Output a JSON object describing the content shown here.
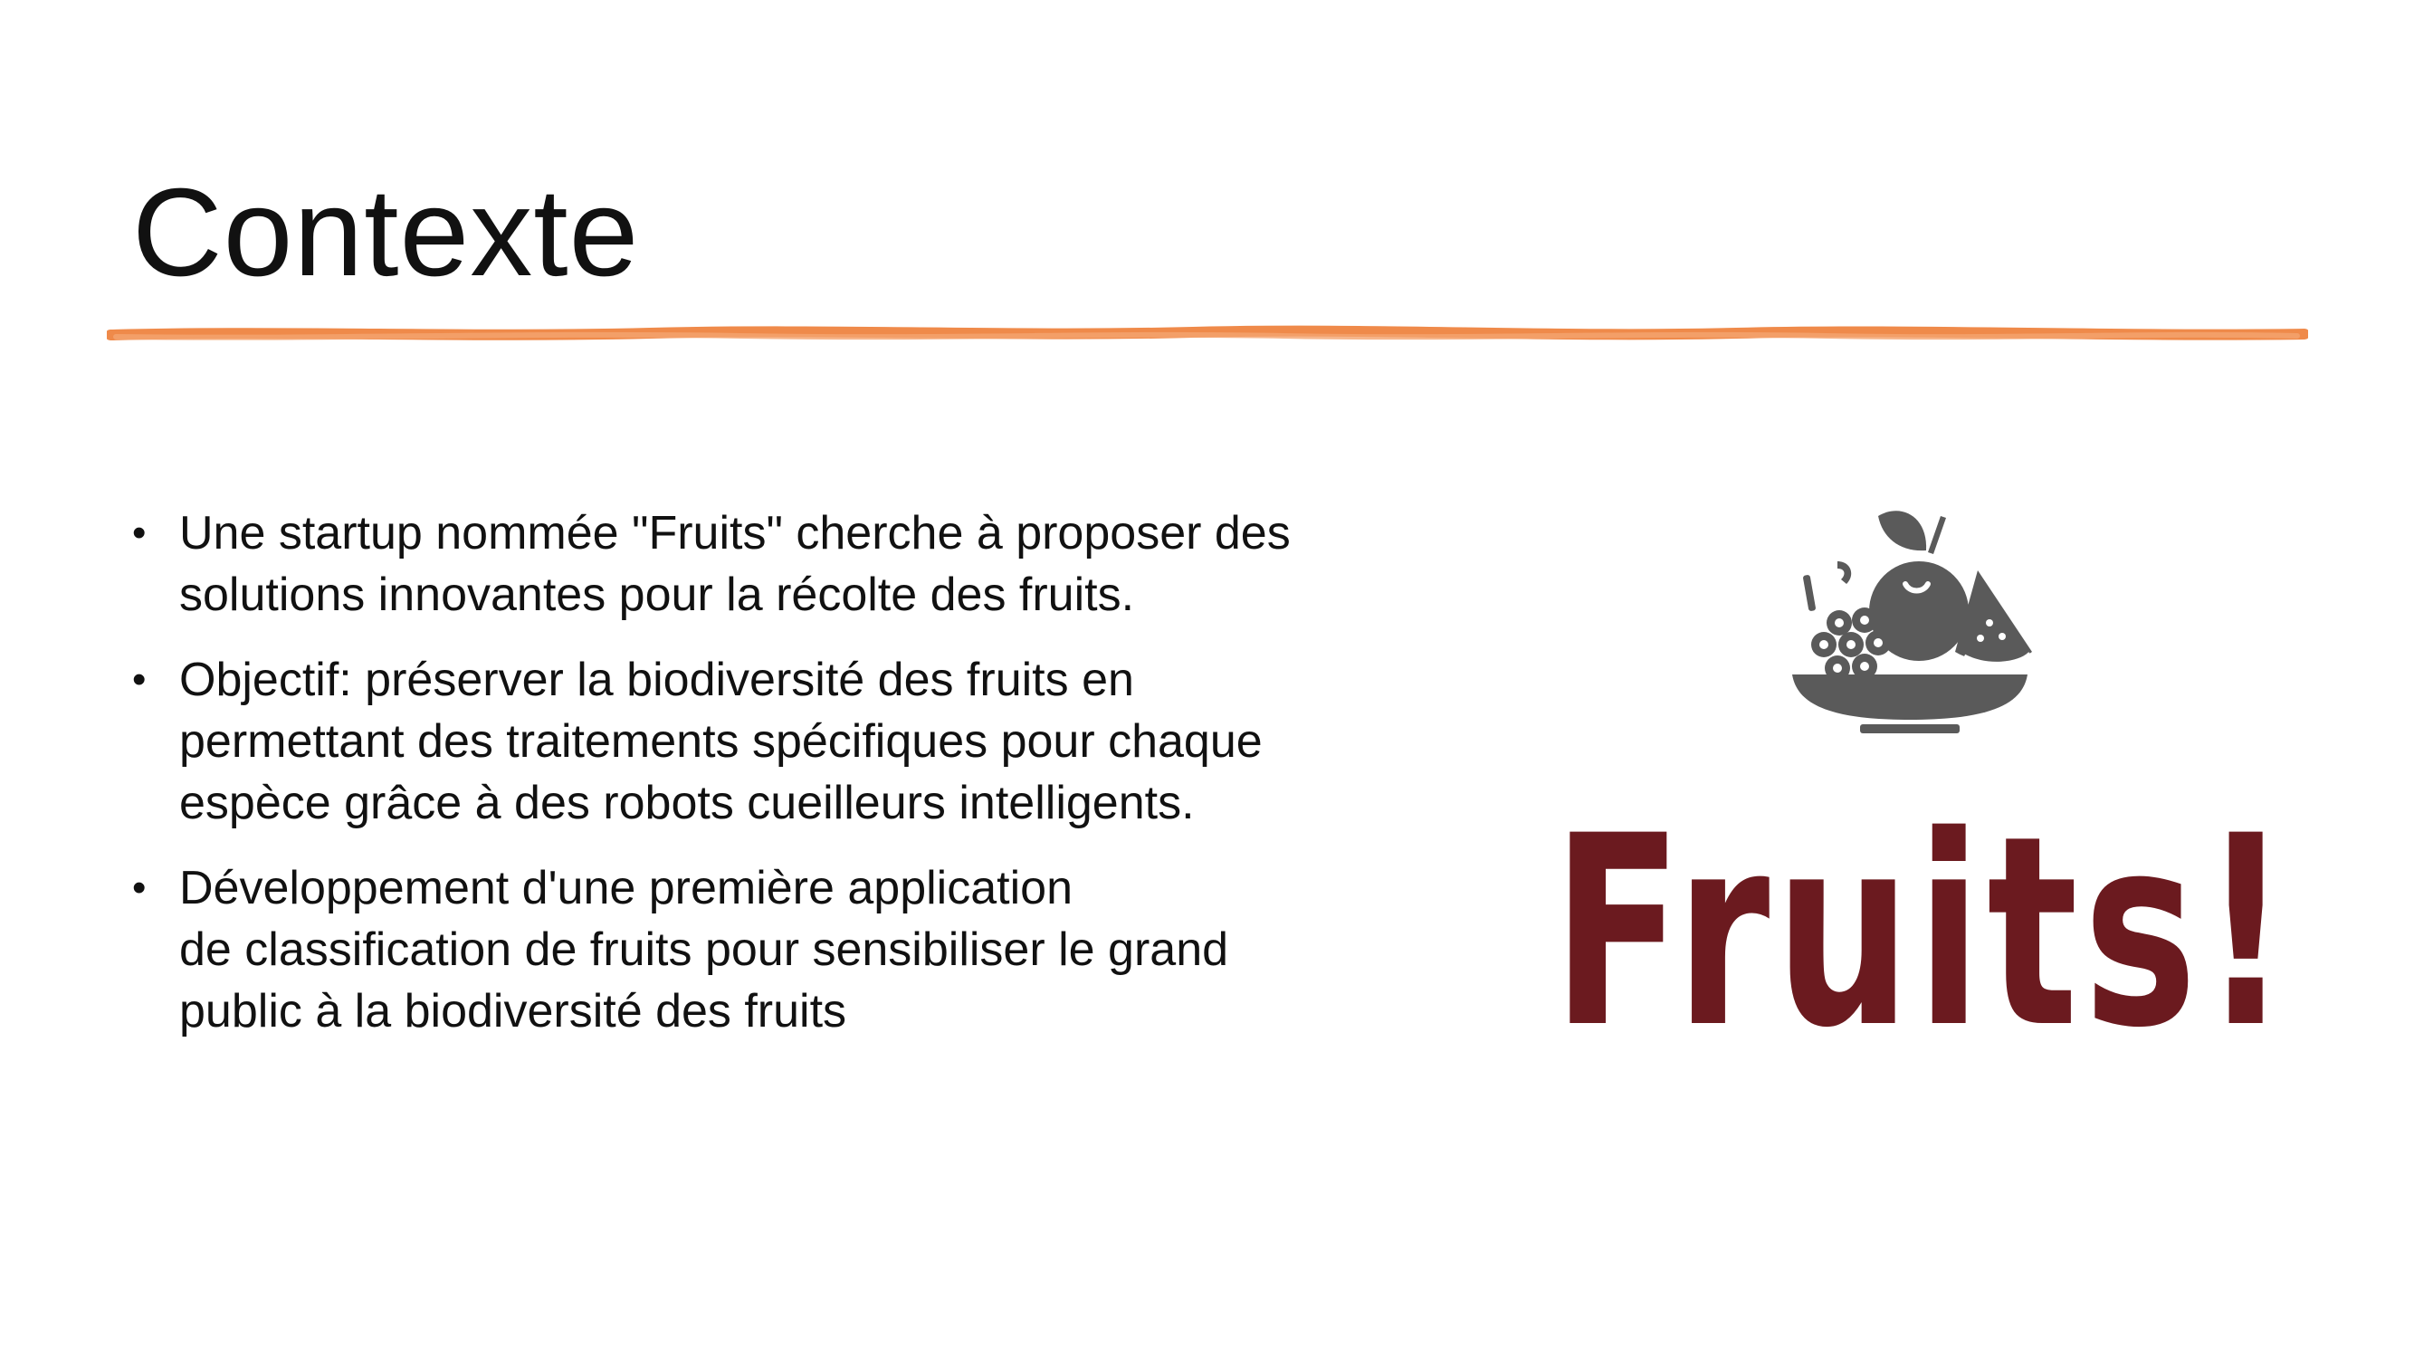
{
  "slide": {
    "title": "Contexte",
    "accent_color": "#ef8a4a",
    "bullets": [
      {
        "lines": [
          "Une startup nommée \"Fruits\" cherche à proposer des",
          "solutions innovantes pour la récolte des fruits."
        ]
      },
      {
        "lines": [
          "Objectif: préserver la biodiversité des fruits en",
          "permettant des traitements spécifiques pour chaque",
          "espèce grâce à des robots cueilleurs intelligents."
        ]
      },
      {
        "lines": [
          "Développement d'une première application",
          "de classification de fruits pour sensibiliser le grand",
          "public à la biodiversité des fruits"
        ]
      }
    ]
  },
  "logo": {
    "icon_name": "fruit-bowl-icon",
    "icon_color": "#5a5a5a",
    "wordmark": "Fruits!",
    "wordmark_color": "#6b1a1f"
  }
}
